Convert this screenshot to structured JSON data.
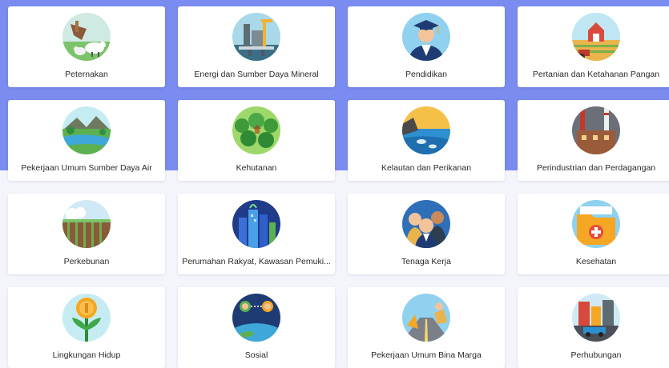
{
  "categories": [
    {
      "label": "Peternakan",
      "icon": "livestock-icon"
    },
    {
      "label": "Energi dan Sumber Daya Mineral",
      "icon": "energy-mining-icon"
    },
    {
      "label": "Pendidikan",
      "icon": "graduate-icon"
    },
    {
      "label": "Pertanian dan Ketahanan Pangan",
      "icon": "farm-barn-icon"
    },
    {
      "label": "Pekerjaan Umum Sumber Daya Air",
      "icon": "river-landscape-icon"
    },
    {
      "label": "Kehutanan",
      "icon": "forest-icon"
    },
    {
      "label": "Kelautan dan Perikanan",
      "icon": "sea-fishery-icon"
    },
    {
      "label": "Perindustrian dan Perdagangan",
      "icon": "factory-icon"
    },
    {
      "label": "Perkebunan",
      "icon": "plantation-icon"
    },
    {
      "label": "Perumahan Rakyat, Kawasan Pemuki...",
      "icon": "city-buildings-icon"
    },
    {
      "label": "Tenaga Kerja",
      "icon": "workers-icon"
    },
    {
      "label": "Kesehatan",
      "icon": "health-folder-icon"
    },
    {
      "label": "Lingkungan Hidup",
      "icon": "coin-plant-icon"
    },
    {
      "label": "Sosial",
      "icon": "social-network-globe-icon"
    },
    {
      "label": "Pekerjaan Umum Bina Marga",
      "icon": "road-construction-icon"
    },
    {
      "label": "Perhubungan",
      "icon": "transport-city-icon"
    }
  ]
}
